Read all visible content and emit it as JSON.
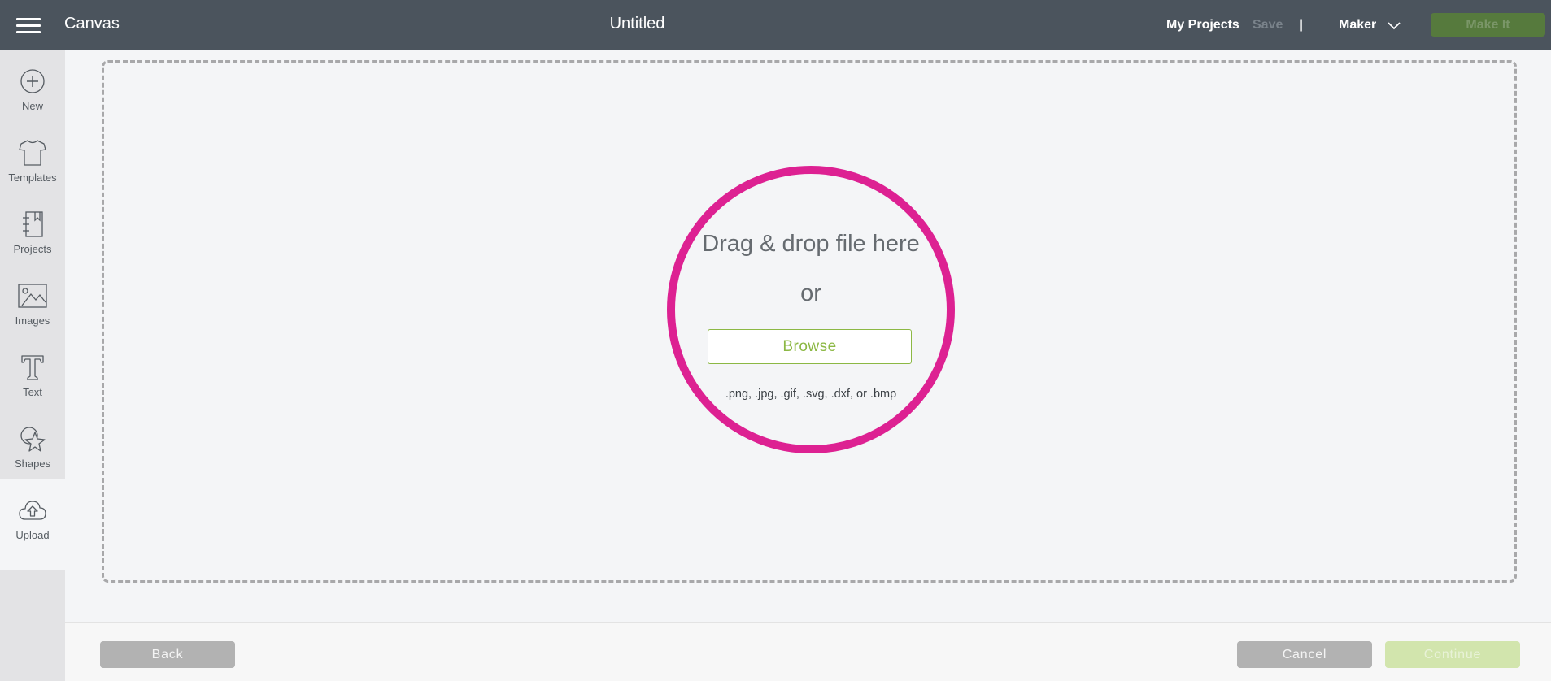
{
  "header": {
    "app_title": "Canvas",
    "document_title": "Untitled",
    "my_projects_label": "My Projects",
    "save_label": "Save",
    "separator": "|",
    "machine_label": "Maker",
    "make_it_label": "Make It"
  },
  "sidebar": {
    "items": [
      {
        "label": "New",
        "icon": "plus-circle-icon"
      },
      {
        "label": "Templates",
        "icon": "tshirt-icon"
      },
      {
        "label": "Projects",
        "icon": "notebook-icon"
      },
      {
        "label": "Images",
        "icon": "image-icon"
      },
      {
        "label": "Text",
        "icon": "text-t-icon"
      },
      {
        "label": "Shapes",
        "icon": "shapes-icon"
      },
      {
        "label": "Upload",
        "icon": "cloud-upload-icon",
        "active": true
      }
    ]
  },
  "upload": {
    "drag_text": "Drag & drop file here",
    "or_text": "or",
    "browse_label": "Browse",
    "file_types": ".png, .jpg, .gif, .svg, .dxf, or .bmp"
  },
  "footer": {
    "back_label": "Back",
    "cancel_label": "Cancel",
    "continue_label": "Continue"
  },
  "colors": {
    "header_bg": "#4b545d",
    "accent_magenta": "#dd2192",
    "accent_green": "#8cb844",
    "make_it_bg": "#567a3d",
    "continue_disabled_bg": "#d2e5ad",
    "button_gray": "#b2b2b2"
  }
}
